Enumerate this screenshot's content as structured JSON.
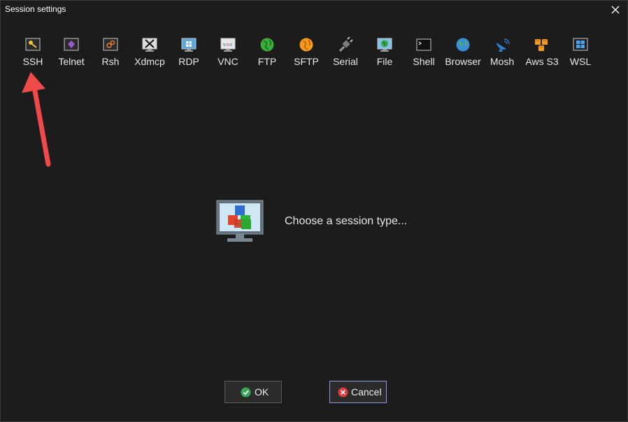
{
  "window": {
    "title": "Session settings"
  },
  "session_types": [
    {
      "label": "SSH",
      "icon": "ssh-key-icon"
    },
    {
      "label": "Telnet",
      "icon": "telnet-icon"
    },
    {
      "label": "Rsh",
      "icon": "rsh-icon"
    },
    {
      "label": "Xdmcp",
      "icon": "xdmcp-icon"
    },
    {
      "label": "RDP",
      "icon": "rdp-icon"
    },
    {
      "label": "VNC",
      "icon": "vnc-icon"
    },
    {
      "label": "FTP",
      "icon": "ftp-globe-icon"
    },
    {
      "label": "SFTP",
      "icon": "sftp-globe-icon"
    },
    {
      "label": "Serial",
      "icon": "serial-plug-icon"
    },
    {
      "label": "File",
      "icon": "file-monitor-icon"
    },
    {
      "label": "Shell",
      "icon": "shell-terminal-icon"
    },
    {
      "label": "Browser",
      "icon": "browser-globe-icon"
    },
    {
      "label": "Mosh",
      "icon": "mosh-dish-icon"
    },
    {
      "label": "Aws S3",
      "icon": "aws-s3-icon"
    },
    {
      "label": "WSL",
      "icon": "wsl-windows-icon"
    }
  ],
  "main": {
    "prompt": "Choose a session type..."
  },
  "buttons": {
    "ok_label": "OK",
    "cancel_label": "Cancel"
  },
  "colors": {
    "background": "#1c1c1c",
    "annotation_arrow": "#ef4a4a",
    "ok_icon": "#3aa757",
    "cancel_icon": "#e03b3b"
  }
}
